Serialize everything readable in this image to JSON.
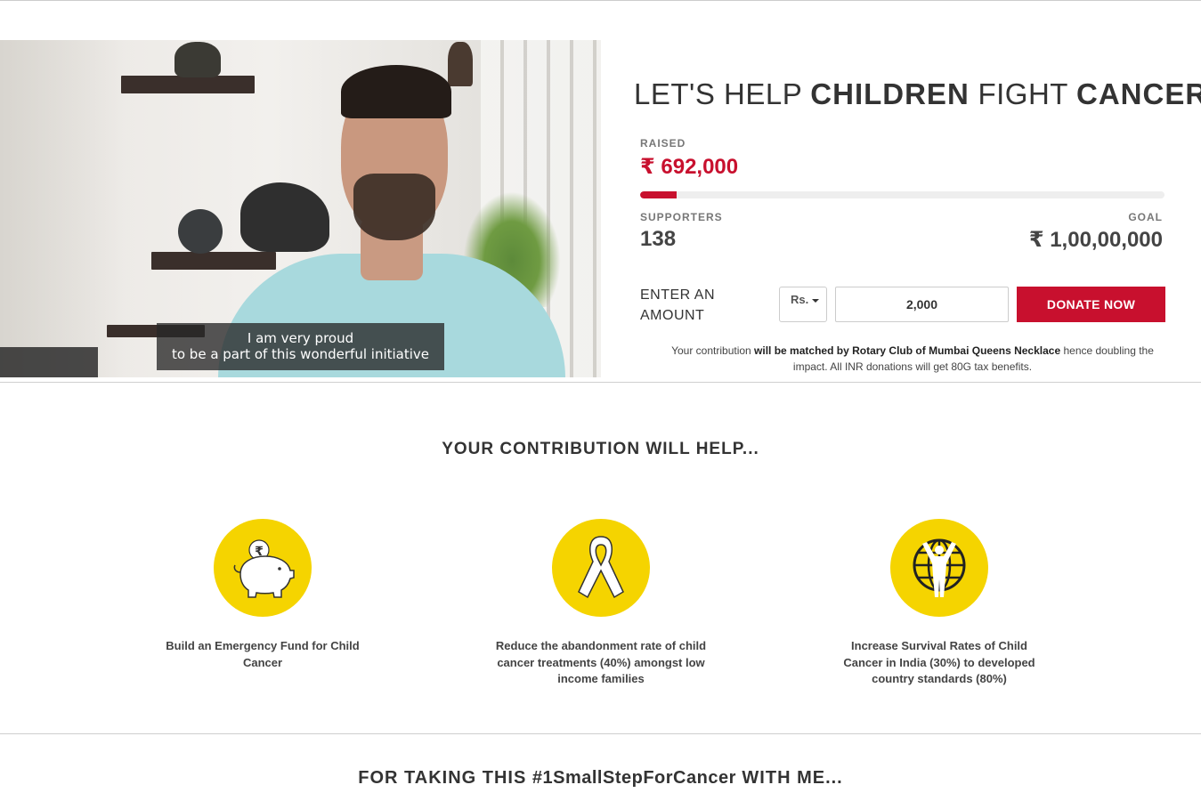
{
  "video": {
    "caption_line1": "I am very proud",
    "caption_line2": "to be a part of this wonderful initiative"
  },
  "campaign": {
    "headline_part1": "LET'S HELP ",
    "headline_bold1": "CHILDREN",
    "headline_part2": " FIGHT ",
    "headline_bold2": "CANCER",
    "raised_label": "RAISED",
    "raised_value": "₹ 692,000",
    "progress_fraction": 0.0692,
    "supporters_label": "SUPPORTERS",
    "supporters_value": "138",
    "goal_label": "GOAL",
    "goal_value": "₹ 1,00,00,000"
  },
  "donation": {
    "amount_label_line1": "ENTER AN",
    "amount_label_line2": "AMOUNT",
    "currency": "Rs.",
    "amount_value": "2,000",
    "donate_label": "DONATE NOW",
    "note_pre": "Your contribution ",
    "note_bold": "will be matched by Rotary Club of Mumbai Queens Necklace",
    "note_post": " hence doubling the impact. All INR donations will get 80G tax benefits."
  },
  "help_section": {
    "title": "YOUR CONTRIBUTION WILL HELP...",
    "features": [
      {
        "icon": "piggy-bank-icon",
        "text": "Build an Emergency Fund for Child Cancer"
      },
      {
        "icon": "cancer-ribbon-icon",
        "text": "Reduce the abandonment rate of child cancer treatments (40%) amongst low income families"
      },
      {
        "icon": "globe-child-icon",
        "text": "Increase Survival Rates of Child Cancer in India (30%) to developed country standards (80%)"
      }
    ]
  },
  "footer_section": {
    "title_pre": "FOR TAKING THIS ",
    "title_bold": "#1SmallStepForCancer",
    "title_post": " WITH ME..."
  },
  "colors": {
    "accent_red": "#c8102e",
    "icon_yellow": "#f5d400"
  }
}
